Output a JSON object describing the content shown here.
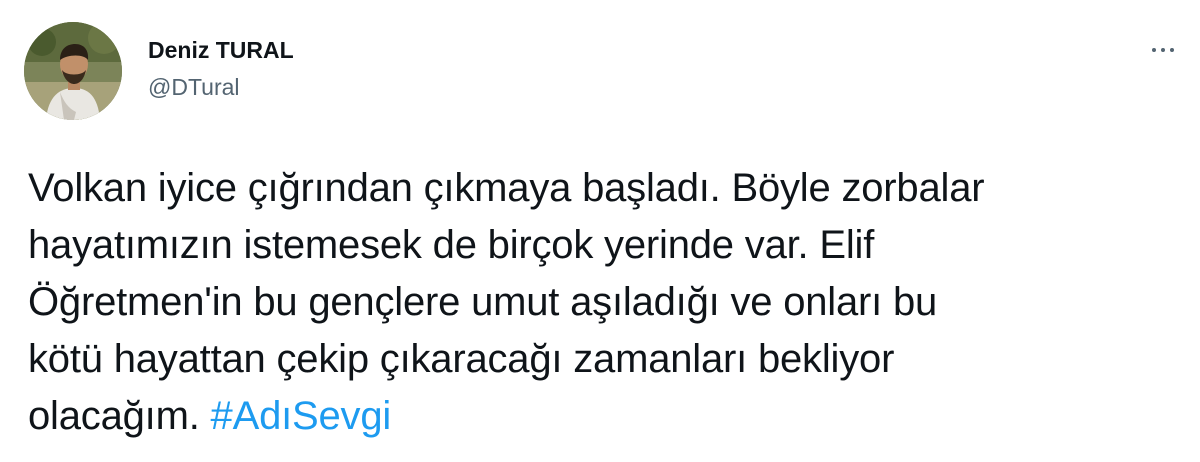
{
  "author": {
    "display_name": "Deniz TURAL",
    "handle": "@DTural"
  },
  "icons": {
    "more": "more-horizontal-icon",
    "avatar": "profile-photo"
  },
  "tweet": {
    "lines": [
      "Volkan iyice çığrından çıkmaya başladı. Böyle zorbalar",
      "hayatımızın istemesek de birçok yerinde var. Elif",
      "Öğretmen'in bu gençlere umut aşıladığı ve onları bu",
      "kötü hayattan çekip çıkaracağı zamanları bekliyor"
    ],
    "last_line_text": "olacağım. ",
    "hashtag": "#AdıSevgi"
  },
  "colors": {
    "text": "#0f1419",
    "secondary": "#536471",
    "link": "#1d9bf0"
  }
}
